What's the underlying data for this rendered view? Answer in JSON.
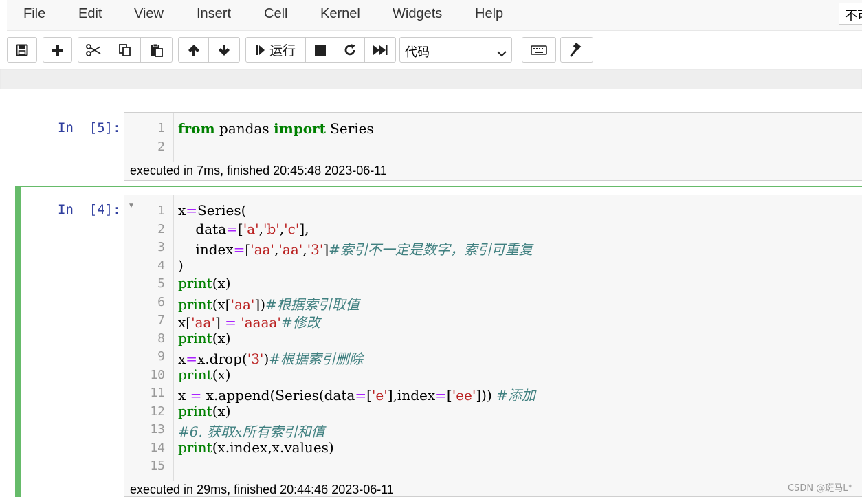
{
  "menu": {
    "items": [
      "File",
      "Edit",
      "View",
      "Insert",
      "Cell",
      "Kernel",
      "Widgets",
      "Help"
    ],
    "kernel_indicator": "不可信"
  },
  "toolbar": {
    "run_label": "运行",
    "cell_type": "代码",
    "icons": [
      "save-icon",
      "plus-icon",
      "cut-icon",
      "copy-icon",
      "paste-icon",
      "arrow-up-icon",
      "arrow-down-icon",
      "step-forward-icon",
      "stop-icon",
      "restart-icon",
      "fast-forward-icon",
      "chevron-down-icon",
      "keyboard-icon",
      "gavel-icon"
    ]
  },
  "cells": [
    {
      "prompt": "In  [5]:",
      "line_numbers": [
        "1",
        "2"
      ],
      "exec_info": "executed in 7ms, finished 20:45:48 2023-06-11"
    },
    {
      "prompt": "In  [4]:",
      "line_numbers": [
        "1",
        "2",
        "3",
        "4",
        "5",
        "6",
        "7",
        "8",
        "9",
        "10",
        "11",
        "12",
        "13",
        "14",
        "15"
      ],
      "exec_info": "executed in 29ms, finished 20:44:46 2023-06-11"
    }
  ],
  "watermark": "CSDN @斑马L*",
  "colors": {
    "keyword": "#008000",
    "string": "#ba2121",
    "operator": "#aa22ff",
    "comment": "#408080",
    "prompt": "#303f9f",
    "selected": "#66bb6a"
  }
}
